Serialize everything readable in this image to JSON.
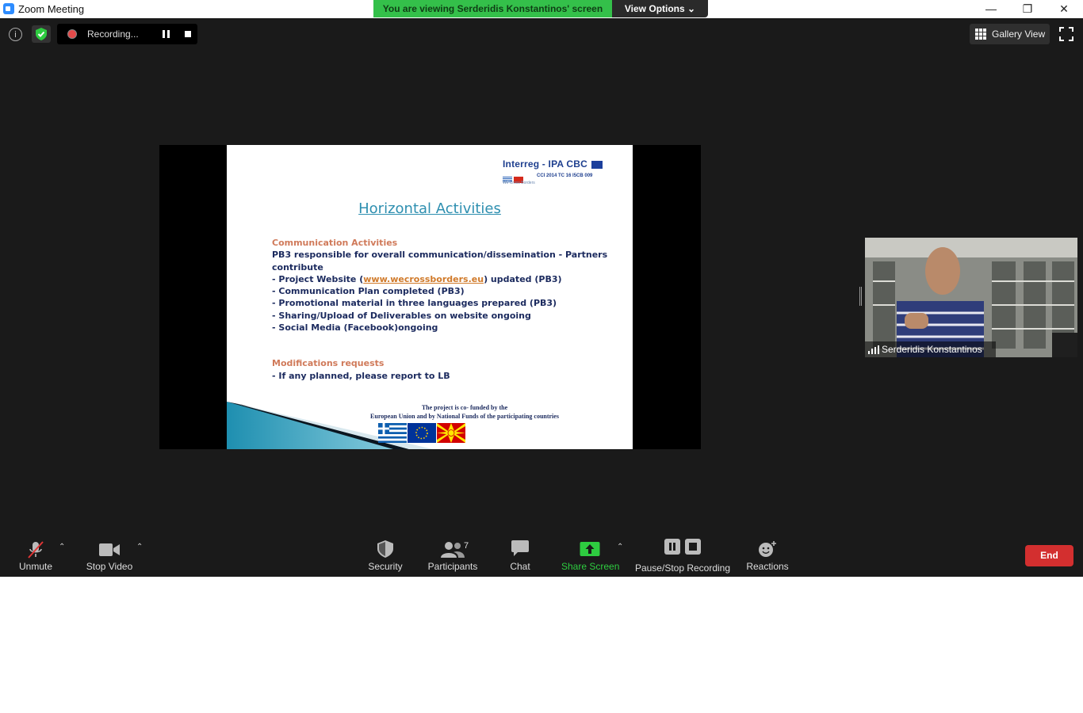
{
  "window": {
    "title": "Zoom Meeting"
  },
  "banner": {
    "viewing_text": "You are viewing Serderidis Konstantinos' screen",
    "options_label": "View Options"
  },
  "recording": {
    "status": "Recording..."
  },
  "view": {
    "gallery_label": "Gallery View"
  },
  "slide": {
    "logo_title": "Interreg - IPA CBC",
    "logo_code": "CCI 2014 TC 16 I5CB 009",
    "logo_tagline": "We Cross Borders",
    "title": "Horizontal Activities",
    "section1_heading": "Communication Activities",
    "line1": "PB3 responsible for overall communication/dissemination - Partners contribute",
    "line2_prefix": "- Project Website (",
    "line2_link": "www.wecrossborders.eu",
    "line2_suffix": ") updated (PB3)",
    "line3": "- Communication Plan completed (PB3)",
    "line4": "- Promotional material in three languages prepared (PB3)",
    "line5": "- Sharing/Upload of Deliverables on website ongoing",
    "line6": "- Social Media (Facebook)ongoing",
    "section2_heading": "Modifications requests",
    "line7": "- If any planned, please report to LB",
    "footer_line1": "The project is co- funded by the",
    "footer_line2": "European Union and by National Funds of the participating countries"
  },
  "participant": {
    "name": "Serderidis Konstantinos"
  },
  "toolbar": {
    "unmute": "Unmute",
    "stop_video": "Stop Video",
    "security": "Security",
    "participants": "Participants",
    "participants_count": "7",
    "chat": "Chat",
    "share_screen": "Share Screen",
    "pause_stop_recording": "Pause/Stop Recording",
    "reactions": "Reactions",
    "end": "End"
  },
  "colors": {
    "share_green": "#2ecc40",
    "end_red": "#d32f2f",
    "banner_green": "#34c04a",
    "slide_title": "#2e8fb0",
    "slide_section": "#d07a5a"
  }
}
